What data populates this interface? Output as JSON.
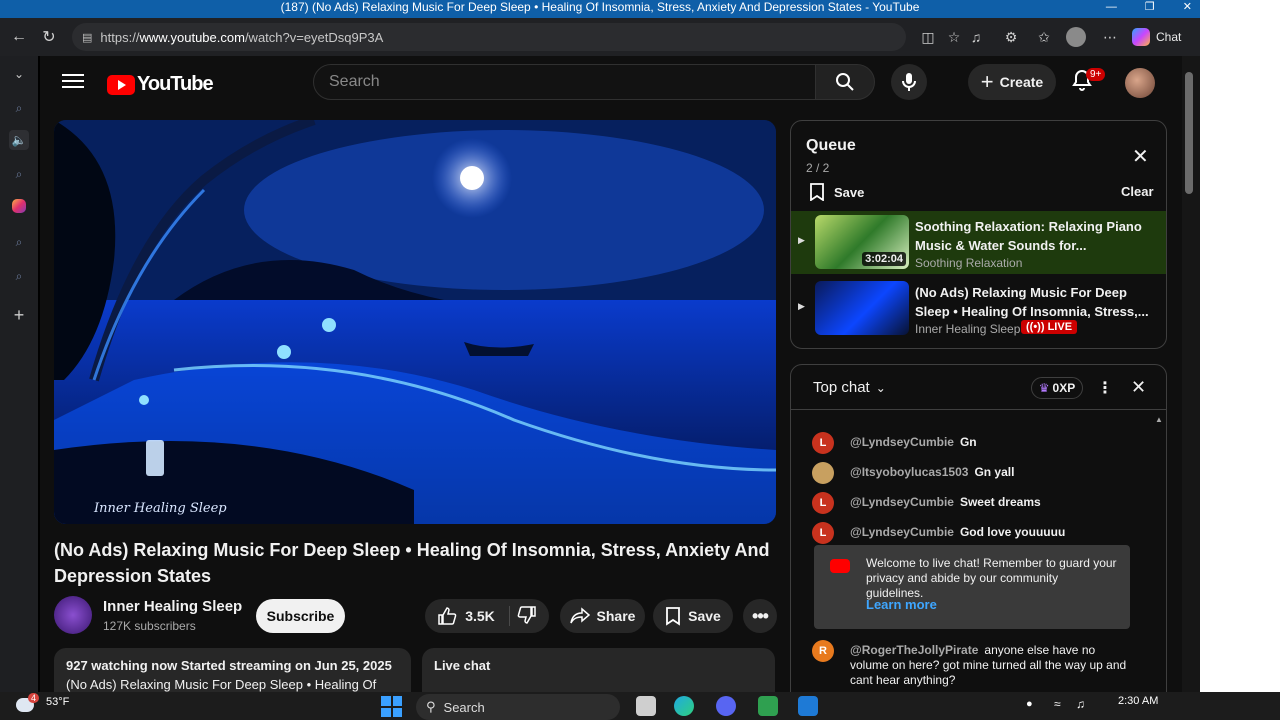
{
  "window": {
    "title": "(187) (No Ads) Relaxing Music For Deep Sleep • Healing Of Insomnia, Stress, Anxiety And Depression States - YouTube"
  },
  "browser": {
    "url_prefix": "https://",
    "url_host": "www.youtube.com",
    "url_path": "/watch?v=eyetDsq9P3A",
    "chat_label": "Chat"
  },
  "youtube": {
    "logo_text": "YouTube",
    "search_placeholder": "Search",
    "create_label": "Create",
    "notification_badge": "9+"
  },
  "video": {
    "title": "(No Ads) Relaxing Music For Deep Sleep • Healing Of Insomnia, Stress, Anxiety And Depression States",
    "watermark": "Inner Healing Sleep",
    "channel_name": "Inner Healing Sleep",
    "subscribers": "127K subscribers",
    "subscribe_label": "Subscribe",
    "likes": "3.5K",
    "share_label": "Share",
    "save_label": "Save",
    "watching": "927 watching now  Started streaming on Jun 25, 2025",
    "desc_preview": "(No Ads) Relaxing Music For Deep Sleep • Healing Of",
    "live_chat_label": "Live chat"
  },
  "queue": {
    "title": "Queue",
    "position": "2 / 2",
    "save_label": "Save",
    "clear_label": "Clear",
    "items": [
      {
        "title": "Soothing Relaxation: Relaxing Piano Music & Water Sounds for...",
        "channel": "Soothing Relaxation",
        "duration": "3:02:04"
      },
      {
        "title": "(No Ads) Relaxing Music For Deep Sleep • Healing Of Insomnia, Stress,...",
        "channel": "Inner Healing Sleep",
        "badge": "LIVE"
      }
    ]
  },
  "chat": {
    "mode": "Top chat",
    "xp": "0XP",
    "messages": [
      {
        "initial": "L",
        "author": "@LyndseyCumbie",
        "text": "Gn",
        "color": "#c8321e"
      },
      {
        "initial": "",
        "author": "@Itsyoboylucas1503",
        "text": "Gn yall",
        "color": "#c8a060"
      },
      {
        "initial": "L",
        "author": "@LyndseyCumbie",
        "text": "Sweet dreams",
        "color": "#c8321e"
      },
      {
        "initial": "L",
        "author": "@LyndseyCumbie",
        "text": "God love youuuuu",
        "color": "#c8321e"
      }
    ],
    "welcome_text": "Welcome to live chat! Remember to guard your privacy and abide by our community guidelines.",
    "learn_more": "Learn more",
    "last_message": {
      "initial": "R",
      "author": "@RogerTheJollyPirate",
      "text": "anyone else have no volume on here? got mine turned all the way up and cant hear anything?",
      "color": "#e87a1e"
    }
  },
  "taskbar": {
    "weather_temp": "53°F",
    "weather_badge": "4",
    "search_label": "Search",
    "time": "2:30 AM"
  }
}
